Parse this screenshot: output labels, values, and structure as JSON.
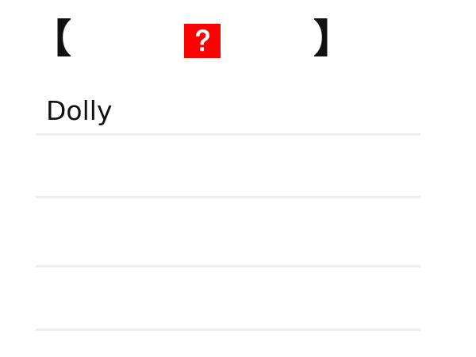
{
  "header": {
    "left_bracket": "【",
    "right_bracket": "】",
    "icon": "question-mark-icon",
    "icon_bg": "#ff0000"
  },
  "list": {
    "items": [
      {
        "label": "Dolly"
      },
      {
        "label": ""
      },
      {
        "label": ""
      },
      {
        "label": ""
      }
    ]
  }
}
